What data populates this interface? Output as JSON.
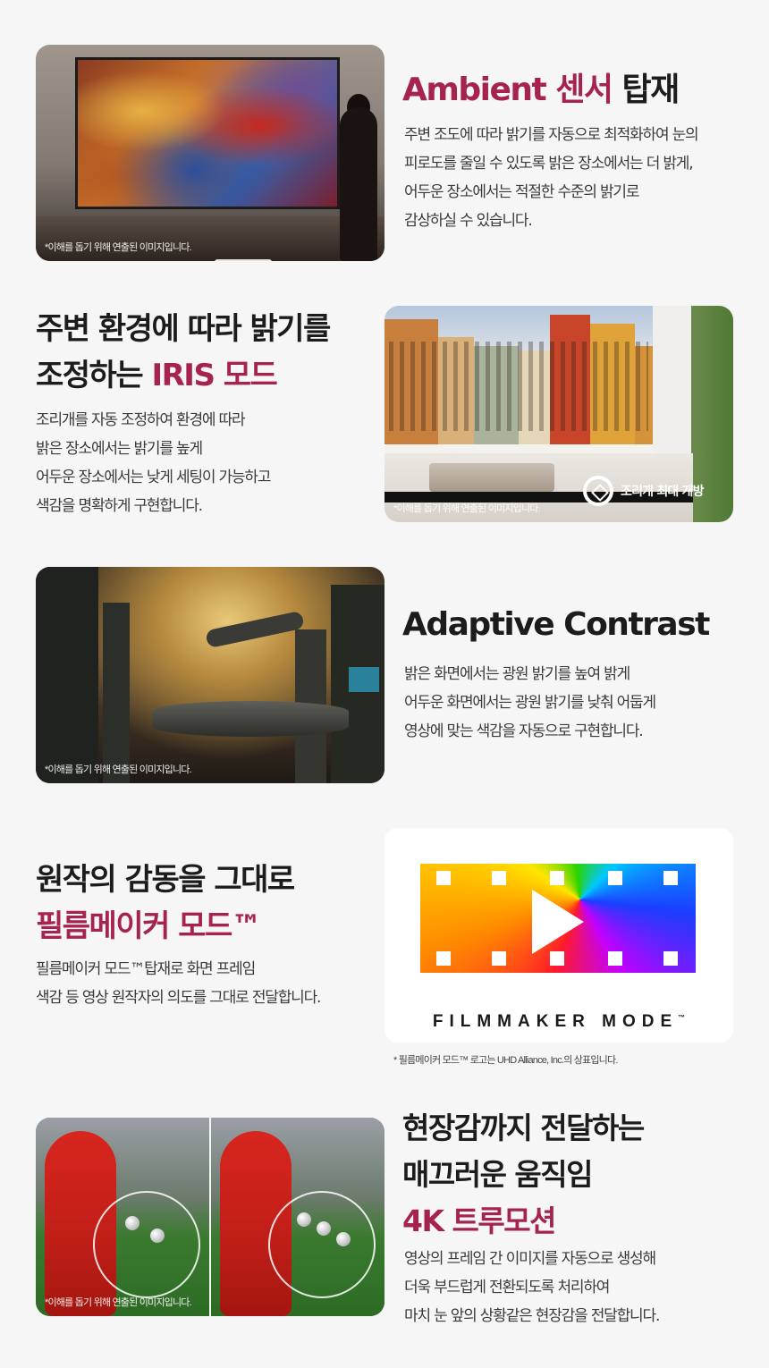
{
  "sections": {
    "ambient": {
      "title_accent": "Ambient 센서",
      "title_rest": " 탑재",
      "body": [
        "주변 조도에 따라 밝기를 자동으로 최적화하여 눈의",
        "피로도를 줄일 수 있도록 밝은 장소에서는 더 밝게,",
        "어두운 장소에서는 적절한 수준의 밝기로",
        "감상하실 수 있습니다."
      ],
      "caption": "*이해를 돕기 위해 연출된 이미지입니다."
    },
    "iris": {
      "title_line1": "주변 환경에 따라 밝기를",
      "title_line2_prefix": "조정하는 ",
      "title_line2_accent": "IRIS 모드",
      "body": [
        "조리개를 자동 조정하여 환경에 따라",
        "밝은 장소에서는 밝기를 높게",
        "어두운 장소에서는 낮게 세팅이 가능하고",
        "색감을 명확하게 구현합니다."
      ],
      "badge": "조리개 최대 개방",
      "caption": "*이해를 돕기 위해 연출된 이미지입니다."
    },
    "adaptive": {
      "title": "Adaptive Contrast",
      "body": [
        "밝은 화면에서는 광원 밝기를 높여 밝게",
        "어두운 화면에서는 광원 밝기를 낮춰 어둡게",
        "영상에 맞는 색감을 자동으로 구현합니다."
      ],
      "caption": "*이해를 돕기 위해 연출된 이미지입니다."
    },
    "filmmaker": {
      "title_line1": "원작의 감동을 그대로",
      "title_line2_accent": "필름메이커 모드™",
      "body": [
        "필름메이커 모드™탑재로 화면 프레임",
        "색감 등 영상 원작자의 의도를 그대로 전달합니다."
      ],
      "logo_text": "FILMMAKER MODE",
      "logo_tm": "™",
      "note": "* 필름메이커 모드™ 로고는 UHD Alliance, Inc.의 상표입니다."
    },
    "truemotion": {
      "title_line1": "현장감까지 전달하는",
      "title_line2": "매끄러운 움직임",
      "title_line3_accent": "4K 트루모션",
      "body": [
        "영상의 프레임 간 이미지를 자동으로 생성해",
        "더욱 부드럽게 전환되도록 처리하여",
        "마치 눈 앞의 상황같은 현장감을 전달합니다."
      ],
      "caption": "*이해를 돕기 위해 연출된 이미지입니다."
    }
  },
  "colors": {
    "accent": "#a6234f",
    "heading": "#1c1c1c",
    "body": "#3a3a3a",
    "background": "#f6f6f6"
  }
}
